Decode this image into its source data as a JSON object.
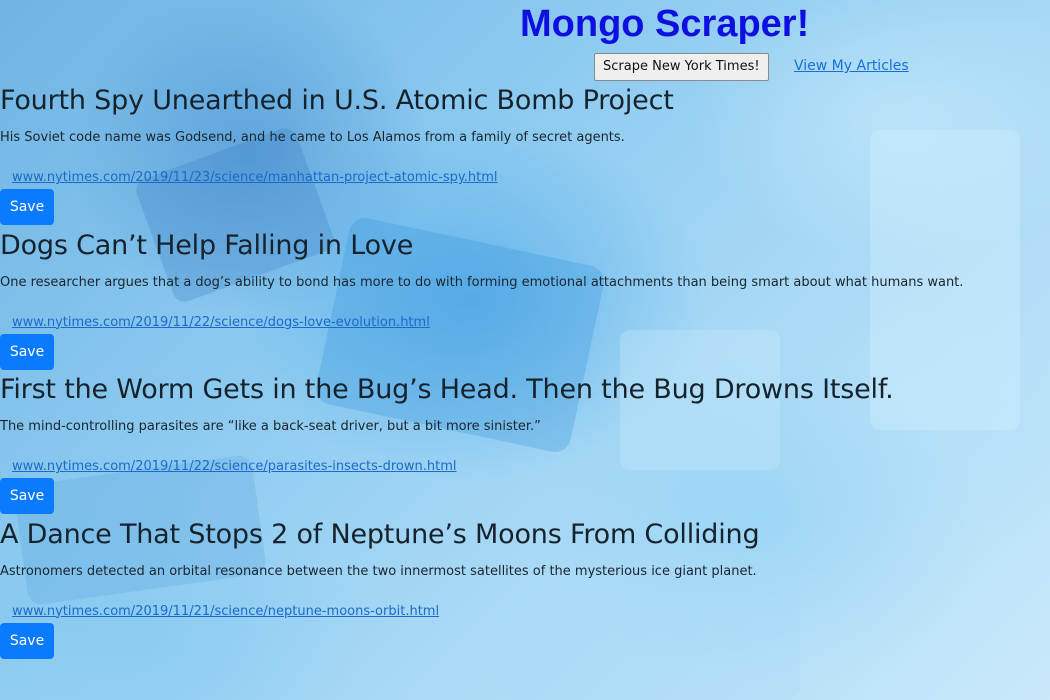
{
  "header": {
    "title": "Mongo Scraper!",
    "scrape_label": "Scrape New York Times!",
    "view_label": "View My Articles"
  },
  "articles": [
    {
      "headline": "Fourth Spy Unearthed in U.S. Atomic Bomb Project",
      "summary": "His Soviet code name was Godsend, and he came to Los Alamos from a family of secret agents.",
      "link": "www.nytimes.com/2019/11/23/science/manhattan-project-atomic-spy.html",
      "save_label": "Save"
    },
    {
      "headline": "Dogs Can’t Help Falling in Love",
      "summary": "One researcher argues that a dog’s ability to bond has more to do with forming emotional attachments than being smart about what humans want.",
      "link": "www.nytimes.com/2019/11/22/science/dogs-love-evolution.html",
      "save_label": "Save"
    },
    {
      "headline": "First the Worm Gets in the Bug’s Head. Then the Bug Drowns Itself.",
      "summary": "The mind-controlling parasites are “like a back-seat driver, but a bit more sinister.”",
      "link": "www.nytimes.com/2019/11/22/science/parasites-insects-drown.html",
      "save_label": "Save"
    },
    {
      "headline": "A Dance That Stops 2 of Neptune’s Moons From Colliding",
      "summary": "Astronomers detected an orbital resonance between the two innermost satellites of the mysterious ice giant planet.",
      "link": "www.nytimes.com/2019/11/21/science/neptune-moons-orbit.html",
      "save_label": "Save"
    }
  ],
  "colors": {
    "title": "#0f0fe0",
    "save_button": "#0a7bff",
    "link": "#1c6ac9"
  }
}
